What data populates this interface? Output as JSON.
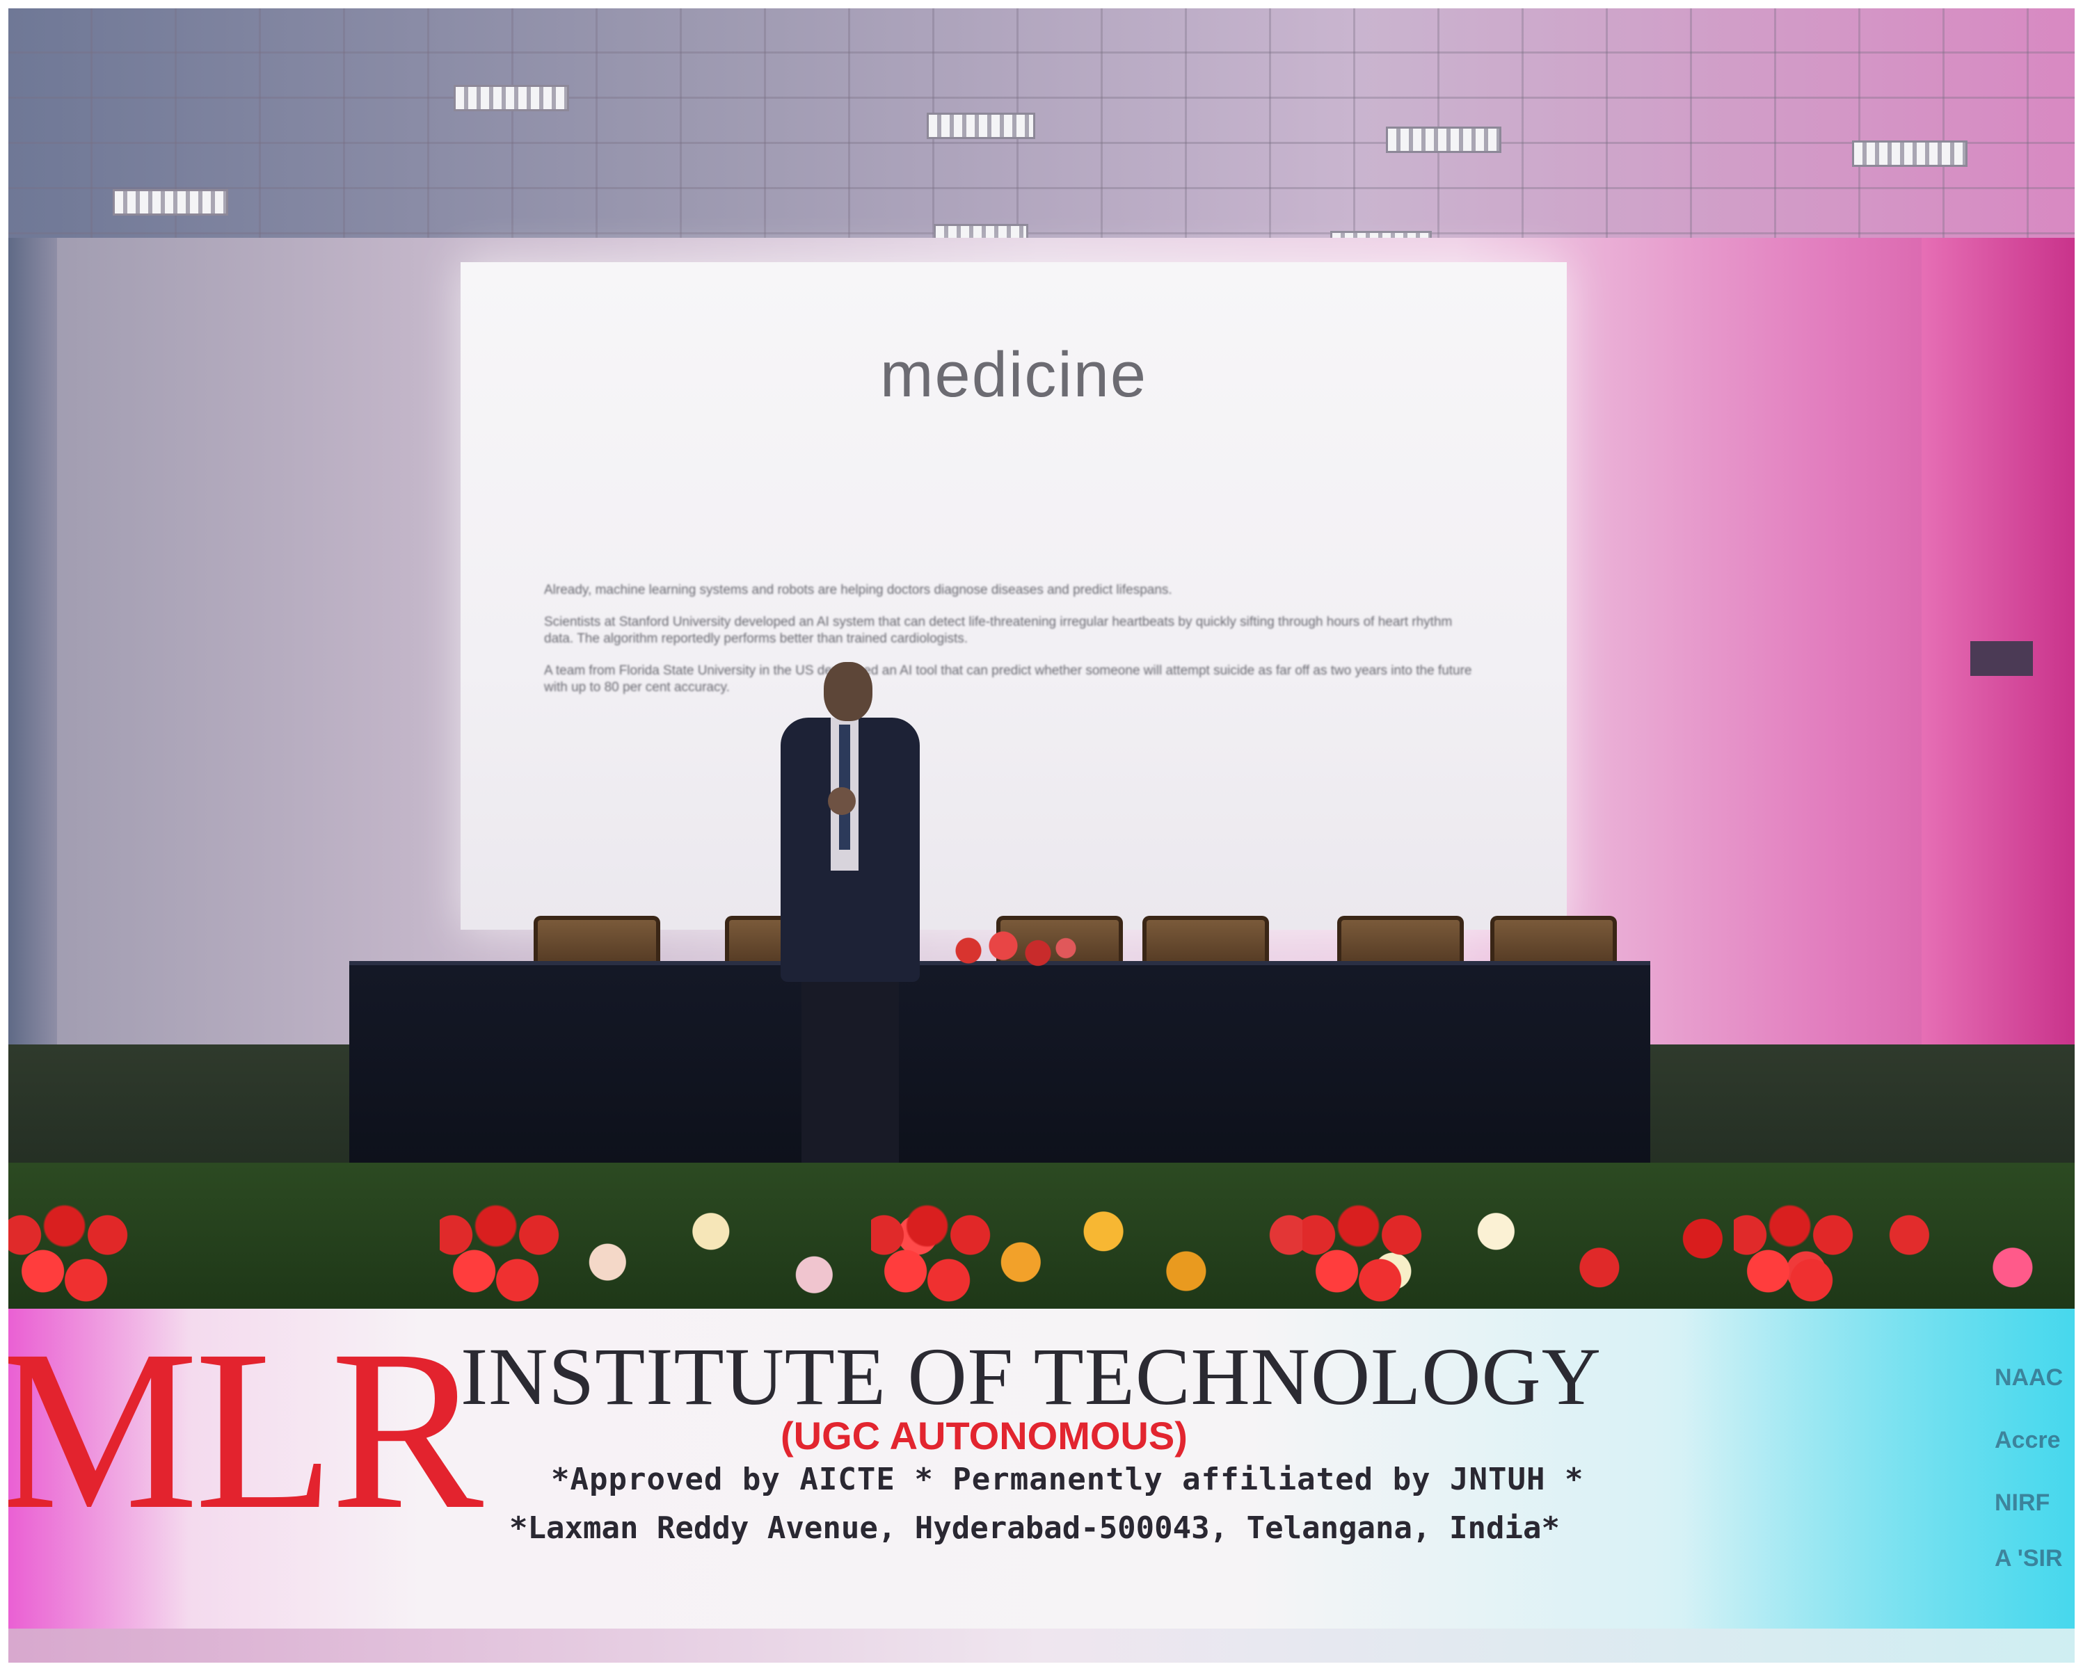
{
  "slide": {
    "title": "medicine",
    "paragraphs": [
      "Already, machine learning systems and robots are helping doctors diagnose diseases and predict lifespans.",
      "Scientists at Stanford University developed an AI system that can detect life-threatening irregular heartbeats by quickly sifting through hours of heart rhythm data. The algorithm reportedly performs better than trained cardiologists.",
      "A team from Florida State University in the US developed an AI tool that can predict whether someone will attempt suicide as far off as two years into the future with up to 80 per cent accuracy."
    ]
  },
  "banner": {
    "logo": "MLR",
    "name": "INSTITUTE OF TECHNOLOGY",
    "status": "(UGC AUTONOMOUS)",
    "approval": "*Approved by AICTE * Permanently  affiliated by JNTUH *",
    "address": "*Laxman Reddy Avenue, Hyderabad-500043, Telangana, India*",
    "side_lines": [
      "NAAC",
      "Accre",
      "NIRF",
      "A 'SIR"
    ]
  },
  "colors": {
    "logo_red": "#e3232e",
    "stage_light_magenta": "#d94b9c",
    "stage_light_cyan": "#8fe6f2"
  }
}
